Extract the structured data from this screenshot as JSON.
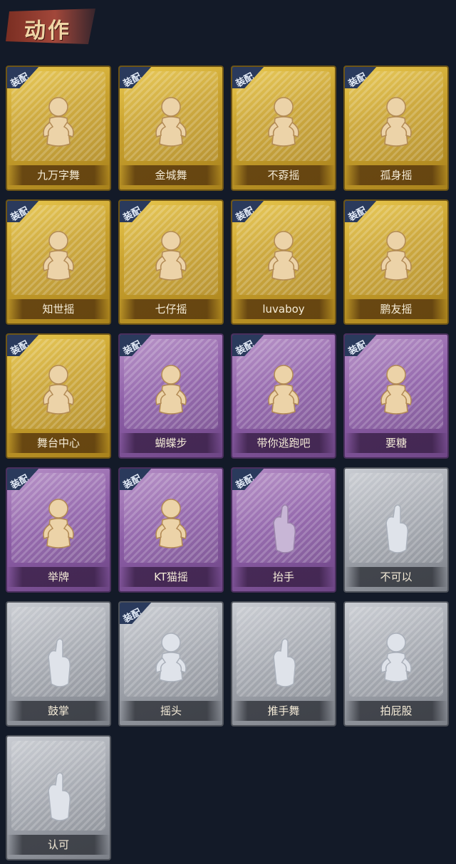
{
  "header": {
    "title": "动作"
  },
  "equip_badge": "装配",
  "colors": {
    "gold": "#d6b13a",
    "purple": "#8d5ea7",
    "gray": "#a3a7af",
    "background": "#131a28"
  },
  "cards": [
    {
      "label": "九万字舞",
      "tier": "gold",
      "equipped": true,
      "icon": "dance-figure-icon"
    },
    {
      "label": "金城舞",
      "tier": "gold",
      "equipped": true,
      "icon": "wave-figure-icon"
    },
    {
      "label": "不孬摇",
      "tier": "gold",
      "equipped": true,
      "icon": "arm-raise-figure-icon"
    },
    {
      "label": "孤身摇",
      "tier": "gold",
      "equipped": true,
      "icon": "sparkle-figure-icon"
    },
    {
      "label": "知世摇",
      "tier": "gold",
      "equipped": true,
      "icon": "music-figure-icon"
    },
    {
      "label": "七仔摇",
      "tier": "gold",
      "equipped": true,
      "icon": "cross-arm-figure-icon"
    },
    {
      "label": "luvaboy",
      "tier": "gold",
      "equipped": true,
      "icon": "point-figure-icon"
    },
    {
      "label": "鹏友摇",
      "tier": "gold",
      "equipped": true,
      "icon": "fist-figure-icon"
    },
    {
      "label": "舞台中心",
      "tier": "gold",
      "equipped": true,
      "icon": "pose-figure-icon"
    },
    {
      "label": "蝴蝶步",
      "tier": "purple",
      "equipped": true,
      "icon": "point-side-figure-icon"
    },
    {
      "label": "带你逃跑吧",
      "tier": "purple",
      "equipped": true,
      "icon": "run-figure-icon"
    },
    {
      "label": "要糖",
      "tier": "purple",
      "equipped": true,
      "icon": "reach-figure-icon"
    },
    {
      "label": "举牌",
      "tier": "purple",
      "equipped": true,
      "icon": "sign-figure-icon"
    },
    {
      "label": "KT猫摇",
      "tier": "purple",
      "equipped": true,
      "icon": "cat-figure-icon"
    },
    {
      "label": "抬手",
      "tier": "purple",
      "equipped": true,
      "icon": "raise-hand-figure-icon"
    },
    {
      "label": "不可以",
      "tier": "gray",
      "equipped": false,
      "icon": "finger-wag-icon"
    },
    {
      "label": "鼓掌",
      "tier": "gray",
      "equipped": false,
      "icon": "clap-hands-icon"
    },
    {
      "label": "摇头",
      "tier": "gray",
      "equipped": true,
      "icon": "shake-head-figure-icon"
    },
    {
      "label": "推手舞",
      "tier": "gray",
      "equipped": false,
      "icon": "push-hands-figure-icon"
    },
    {
      "label": "拍屁股",
      "tier": "gray",
      "equipped": false,
      "icon": "bend-figure-icon"
    },
    {
      "label": "认可",
      "tier": "gray",
      "equipped": false,
      "icon": "thumbs-up-icon"
    }
  ]
}
